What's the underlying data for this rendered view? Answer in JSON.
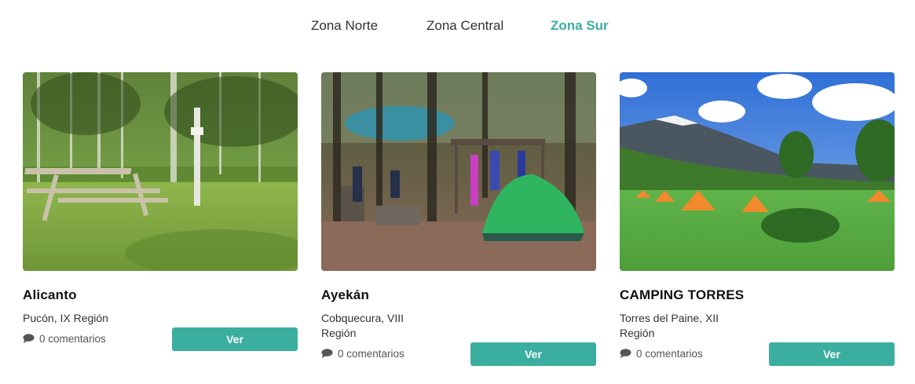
{
  "tabs": [
    {
      "label": "Zona Norte",
      "active": false
    },
    {
      "label": "Zona Central",
      "active": false
    },
    {
      "label": "Zona Sur",
      "active": true
    }
  ],
  "colors": {
    "accent": "#3aae9f",
    "button_text": "#ffffff",
    "title": "#111111",
    "body_text": "#333333",
    "muted_text": "#555555"
  },
  "cards": [
    {
      "title": "Alicanto",
      "location": "Pucón, IX Región",
      "image": "forest-picnic-table-photo",
      "comments": "0 comentarios",
      "comment_icon": "speech-bubble-icon",
      "button": "Ver"
    },
    {
      "title": "Ayekán",
      "location": "Cobquecura, VIII Región",
      "image": "forest-campsite-green-tent-photo",
      "comments": "0 comentarios",
      "comment_icon": "speech-bubble-icon",
      "button": "Ver"
    },
    {
      "title": "CAMPING TORRES",
      "location": "Torres del Paine, XII Región",
      "image": "mountain-meadow-orange-tents-photo",
      "comments": "0 comentarios",
      "comment_icon": "speech-bubble-icon",
      "button": "Ver"
    }
  ]
}
